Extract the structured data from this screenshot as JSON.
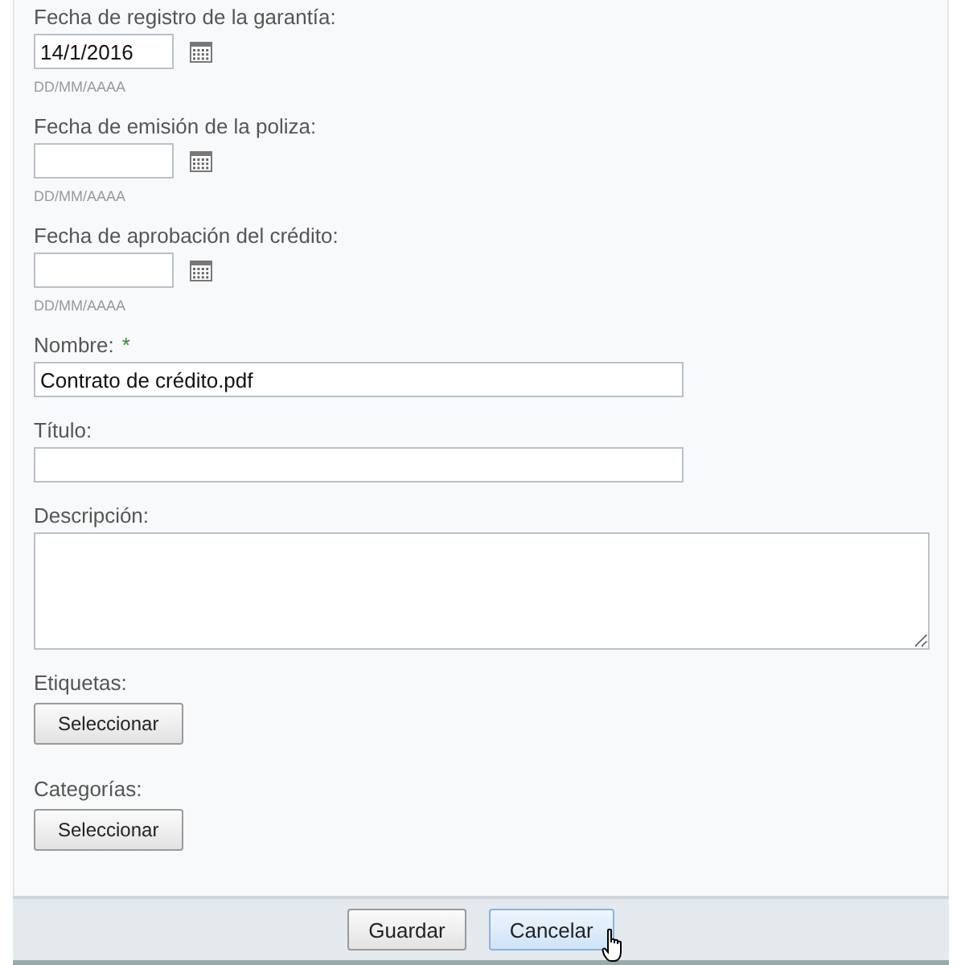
{
  "date_fields": [
    {
      "label": "Fecha de registro de la garantía:",
      "value": "14/1/2016",
      "hint": "DD/MM/AAAA"
    },
    {
      "label": "Fecha de emisión de la poliza:",
      "hint": "DD/MM/AAAA"
    },
    {
      "label": "Fecha de aprobación del crédito:",
      "hint": "DD/MM/AAAA"
    }
  ],
  "fields": [
    {
      "kind": "text",
      "label": "Nombre:",
      "required_mark": "*",
      "value": "Contrato de crédito.pdf"
    },
    {
      "kind": "text",
      "label": "Título:"
    },
    {
      "kind": "textarea",
      "label": "Descripción:"
    },
    {
      "kind": "select",
      "label": "Etiquetas:",
      "button": "Seleccionar"
    },
    {
      "kind": "select",
      "label": "Categorías:",
      "button": "Seleccionar"
    }
  ],
  "footer_buttons": [
    {
      "label": "Guardar",
      "hovered": false
    },
    {
      "label": "Cancelar",
      "hovered": true
    }
  ]
}
